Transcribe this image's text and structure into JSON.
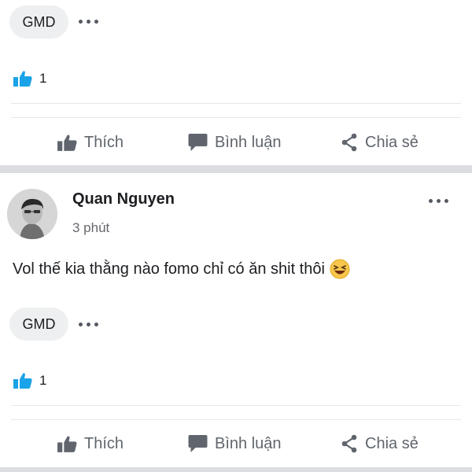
{
  "post1": {
    "tag_label": "GMD",
    "like_count": "1",
    "actions": {
      "like": "Thích",
      "comment": "Bình luận",
      "share": "Chia sẻ"
    }
  },
  "post2": {
    "author": "Quan Nguyen",
    "time": "3 phút",
    "content": "Vol thế kia thằng nào fomo chỉ có ăn shit thôi",
    "emoji": "laughing-face-emoji",
    "tag_label": "GMD",
    "like_count": "1",
    "actions": {
      "like": "Thích",
      "comment": "Bình luận",
      "share": "Chia sẻ"
    }
  },
  "colors": {
    "like_blue": "#1aa3e8",
    "action_gray": "#60656d",
    "separator": "#dcdde0"
  },
  "icons": [
    "thumbs-up-icon",
    "comment-bubble-icon",
    "share-icon",
    "more-dots-icon"
  ]
}
